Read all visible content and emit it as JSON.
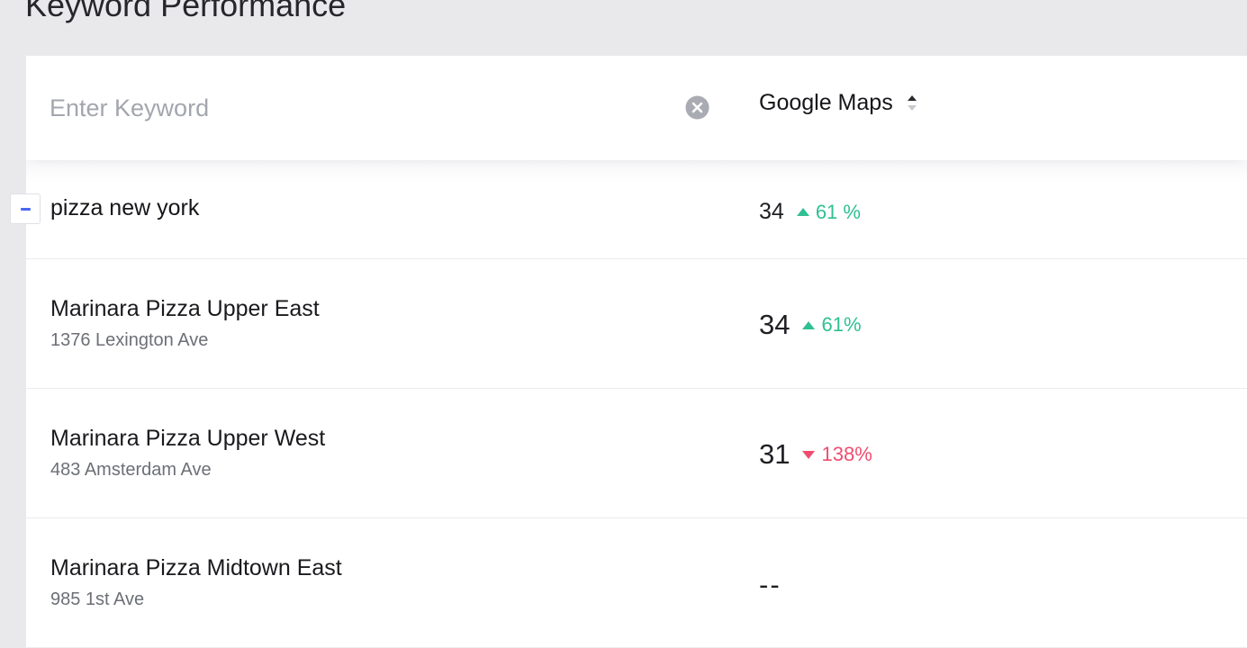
{
  "page_title": "Keyword Performance",
  "search": {
    "placeholder": "Enter Keyword",
    "value": ""
  },
  "column": {
    "label": "Google Maps",
    "sort_icon": "sort-up-icon"
  },
  "keyword_row": {
    "keyword": "pizza new york",
    "rank": "34",
    "change": "61 %",
    "direction": "up"
  },
  "locations": [
    {
      "name": "Marinara Pizza Upper East",
      "address": "1376 Lexington Ave",
      "rank": "34",
      "change": "61%",
      "direction": "up"
    },
    {
      "name": "Marinara Pizza Upper West",
      "address": "483 Amsterdam Ave",
      "rank": "31",
      "change": "138%",
      "direction": "down"
    },
    {
      "name": "Marinara Pizza Midtown East",
      "address": "985 1st Ave",
      "rank": "--",
      "change": "",
      "direction": "none"
    }
  ],
  "colors": {
    "up": "#2fc093",
    "down": "#ef4d6f",
    "accent": "#4a67ef",
    "background": "#e9e9ec"
  }
}
